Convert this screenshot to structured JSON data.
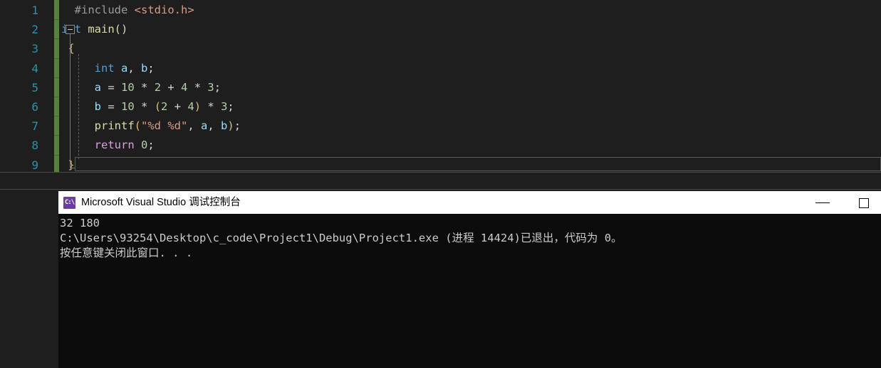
{
  "editor": {
    "name": "visual-studio-code-editor",
    "background": "#1e1e1e",
    "line_number_color": "#2b91af",
    "change_bar_color": "#57803a",
    "line_numbers": [
      "1",
      "2",
      "3",
      "4",
      "5",
      "6",
      "7",
      "8",
      "9"
    ],
    "lines": [
      {
        "number": "1",
        "tokens": [
          {
            "text": "  ",
            "cls": "t-punc"
          },
          {
            "text": "#include",
            "cls": "t-pre"
          },
          {
            "text": " ",
            "cls": "t-punc"
          },
          {
            "text": "<stdio.h>",
            "cls": "t-header"
          }
        ]
      },
      {
        "number": "2",
        "tokens": [
          {
            "text": "int",
            "cls": "t-kw"
          },
          {
            "text": " ",
            "cls": "t-punc"
          },
          {
            "text": "main",
            "cls": "t-fn"
          },
          {
            "text": "()",
            "cls": "t-paren"
          }
        ]
      },
      {
        "number": "3",
        "tokens": [
          {
            "text": " ",
            "cls": "t-punc"
          },
          {
            "text": "{",
            "cls": "t-brace1"
          }
        ]
      },
      {
        "number": "4",
        "tokens": [
          {
            "text": "     ",
            "cls": "t-punc"
          },
          {
            "text": "int",
            "cls": "t-kw"
          },
          {
            "text": " ",
            "cls": "t-punc"
          },
          {
            "text": "a",
            "cls": "t-var"
          },
          {
            "text": ", ",
            "cls": "t-punc"
          },
          {
            "text": "b",
            "cls": "t-var"
          },
          {
            "text": ";",
            "cls": "t-punc"
          }
        ]
      },
      {
        "number": "5",
        "tokens": [
          {
            "text": "     ",
            "cls": "t-punc"
          },
          {
            "text": "a",
            "cls": "t-var"
          },
          {
            "text": " = ",
            "cls": "t-op"
          },
          {
            "text": "10",
            "cls": "t-num"
          },
          {
            "text": " * ",
            "cls": "t-op"
          },
          {
            "text": "2",
            "cls": "t-num"
          },
          {
            "text": " + ",
            "cls": "t-op"
          },
          {
            "text": "4",
            "cls": "t-num"
          },
          {
            "text": " * ",
            "cls": "t-op"
          },
          {
            "text": "3",
            "cls": "t-num"
          },
          {
            "text": ";",
            "cls": "t-punc"
          }
        ]
      },
      {
        "number": "6",
        "tokens": [
          {
            "text": "     ",
            "cls": "t-punc"
          },
          {
            "text": "b",
            "cls": "t-var"
          },
          {
            "text": " = ",
            "cls": "t-op"
          },
          {
            "text": "10",
            "cls": "t-num"
          },
          {
            "text": " * ",
            "cls": "t-op"
          },
          {
            "text": "(",
            "cls": "t-brace1"
          },
          {
            "text": "2",
            "cls": "t-num"
          },
          {
            "text": " + ",
            "cls": "t-op"
          },
          {
            "text": "4",
            "cls": "t-num"
          },
          {
            "text": ")",
            "cls": "t-brace1"
          },
          {
            "text": " * ",
            "cls": "t-op"
          },
          {
            "text": "3",
            "cls": "t-num"
          },
          {
            "text": ";",
            "cls": "t-punc"
          }
        ]
      },
      {
        "number": "7",
        "tokens": [
          {
            "text": "     ",
            "cls": "t-punc"
          },
          {
            "text": "printf",
            "cls": "t-fn"
          },
          {
            "text": "(",
            "cls": "t-brace1"
          },
          {
            "text": "\"%d %d\"",
            "cls": "t-str"
          },
          {
            "text": ", ",
            "cls": "t-punc"
          },
          {
            "text": "a",
            "cls": "t-var"
          },
          {
            "text": ", ",
            "cls": "t-punc"
          },
          {
            "text": "b",
            "cls": "t-var"
          },
          {
            "text": ")",
            "cls": "t-brace1"
          },
          {
            "text": ";",
            "cls": "t-punc"
          }
        ]
      },
      {
        "number": "8",
        "tokens": [
          {
            "text": "     ",
            "cls": "t-punc"
          },
          {
            "text": "return",
            "cls": "t-ctrl"
          },
          {
            "text": " ",
            "cls": "t-punc"
          },
          {
            "text": "0",
            "cls": "t-num"
          },
          {
            "text": ";",
            "cls": "t-punc"
          }
        ]
      },
      {
        "number": "9",
        "tokens": [
          {
            "text": " ",
            "cls": "t-punc"
          },
          {
            "text": "}",
            "cls": "t-brace1"
          }
        ]
      }
    ],
    "outlining": {
      "collapse_icon": "collapse-minus-icon",
      "collapse_line": "2"
    }
  },
  "console": {
    "name": "debug-console-window",
    "title": "Microsoft Visual Studio 调试控制台",
    "icon": "console-app-icon",
    "icon_text": "C:\\",
    "titlebar_background": "#ffffff",
    "body_background": "#0c0c0c",
    "text_color": "#cccccc",
    "window_controls": {
      "minimize": "minimize-icon",
      "maximize": "maximize-icon",
      "close": "close-icon"
    },
    "output_lines": [
      "32 180",
      "C:\\Users\\93254\\Desktop\\c_code\\Project1\\Debug\\Project1.exe (进程 14424)已退出，代码为 0。",
      "按任意键关闭此窗口. . ."
    ]
  }
}
